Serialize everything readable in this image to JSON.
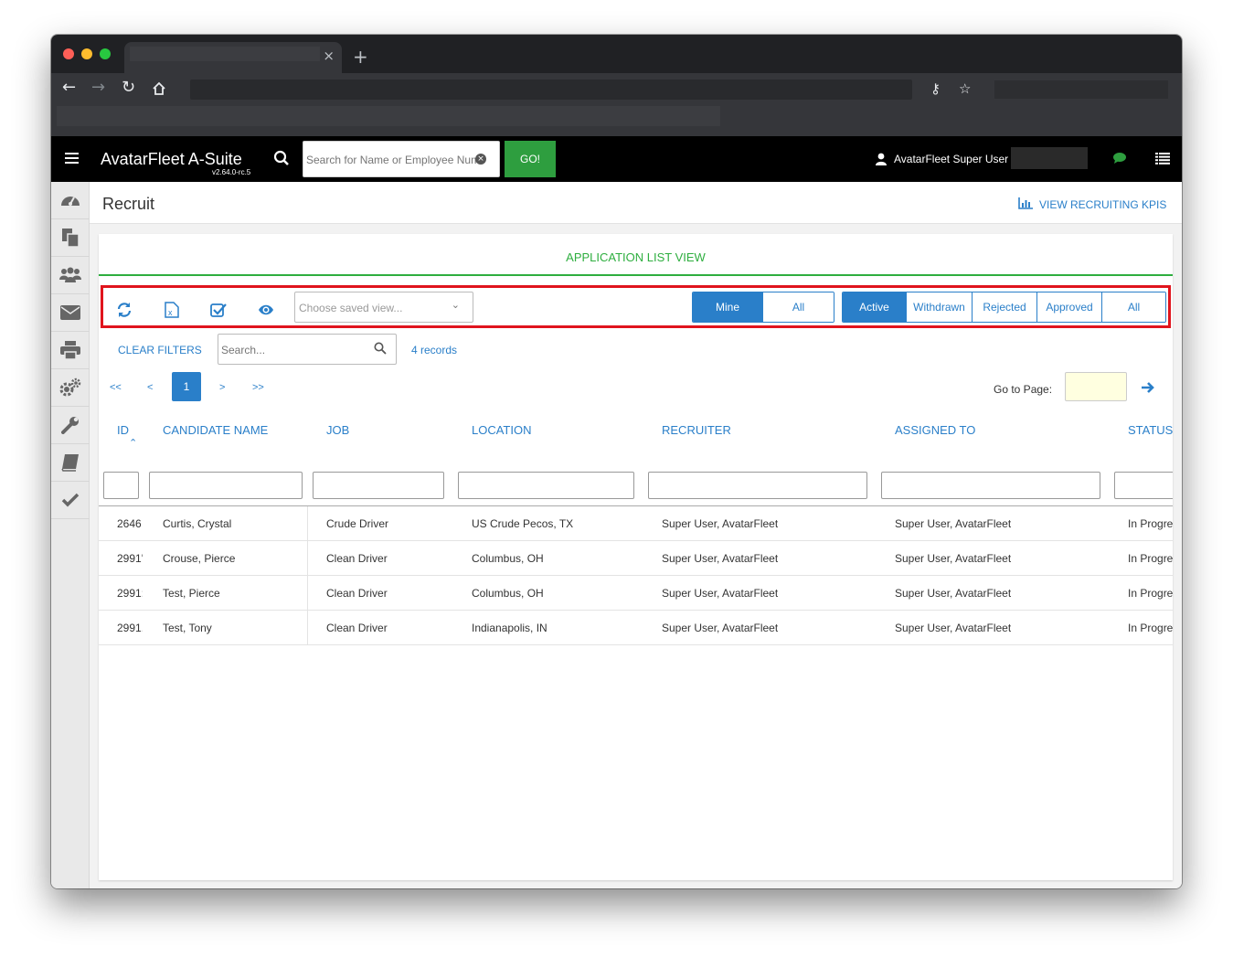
{
  "browser": {
    "new_tab_label": "+",
    "tab_close": "×"
  },
  "app": {
    "brand": "AvatarFleet A-Suite",
    "version": "v2.64.0-rc.5",
    "top_search_placeholder": "Search for Name or Employee Number",
    "go_label": "GO!",
    "user_name": "AvatarFleet Super User"
  },
  "sidebar": {
    "items": [
      "dashboard",
      "documents",
      "people",
      "mail",
      "print",
      "settings",
      "tools",
      "book",
      "checkmark"
    ]
  },
  "page": {
    "title": "Recruit",
    "kpi_link": "VIEW RECRUITING KPIS"
  },
  "card": {
    "title": "APPLICATION LIST VIEW",
    "saved_view_placeholder": "Choose saved view...",
    "owner_filter": [
      "Mine",
      "All"
    ],
    "owner_selected": "Mine",
    "status_filter": [
      "Active",
      "Withdrawn",
      "Rejected",
      "Approved",
      "All"
    ],
    "status_selected": "Active",
    "clear_filters": "CLEAR FILTERS",
    "search_placeholder": "Search...",
    "records": "4 records"
  },
  "pager": {
    "first": "<<",
    "prev": "<",
    "current": "1",
    "next": ">",
    "last": ">>",
    "goto_label": "Go to Page:"
  },
  "table": {
    "columns": [
      "ID",
      "CANDIDATE NAME",
      "JOB",
      "LOCATION",
      "RECRUITER",
      "ASSIGNED TO",
      "STATUS"
    ],
    "rows": [
      {
        "id": "2646",
        "name": "Curtis, Crystal",
        "job": "Crude Driver",
        "location": "US Crude Pecos, TX",
        "recruiter": "Super User, AvatarFleet",
        "assigned": "Super User, AvatarFleet",
        "status": "In Progress"
      },
      {
        "id": "2991'",
        "name": "Crouse, Pierce",
        "job": "Clean Driver",
        "location": "Columbus, OH",
        "recruiter": "Super User, AvatarFleet",
        "assigned": "Super User, AvatarFleet",
        "status": "In Progress"
      },
      {
        "id": "2991:",
        "name": "Test, Pierce",
        "job": "Clean Driver",
        "location": "Columbus, OH",
        "recruiter": "Super User, AvatarFleet",
        "assigned": "Super User, AvatarFleet",
        "status": "In Progress"
      },
      {
        "id": "2991.",
        "name": "Test, Tony",
        "job": "Clean Driver",
        "location": "Indianapolis, IN",
        "recruiter": "Super User, AvatarFleet",
        "assigned": "Super User, AvatarFleet",
        "status": "In Progress"
      }
    ]
  },
  "colors": {
    "accent_blue": "#2a7fc9",
    "accent_green": "#2eae3f",
    "highlight_red": "#e0141d"
  }
}
